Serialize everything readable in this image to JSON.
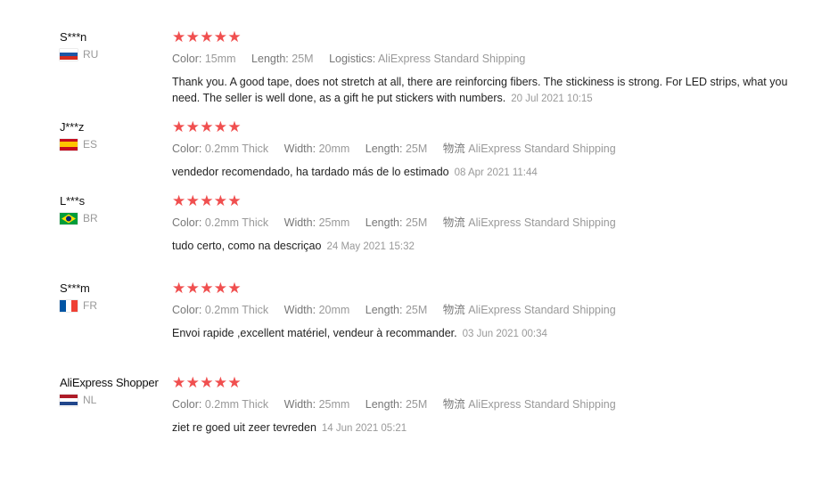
{
  "reviews": [
    {
      "user": "S***n",
      "country": "RU",
      "stars": "★★★★★",
      "attrs": [
        {
          "key": "Color:",
          "value": "15mm"
        },
        {
          "key": "Length:",
          "value": "25M"
        },
        {
          "key": "Logistics:",
          "value": "AliExpress Standard Shipping"
        }
      ],
      "text": "Thank you. A good tape, does not stretch at all, there are reinforcing fibers. The stickiness is strong. For LED strips, what you need. The seller is well done, as a gift he put stickers with numbers.",
      "date": "20 Jul 2021 10:15"
    },
    {
      "user": "J***z",
      "country": "ES",
      "stars": "★★★★★",
      "attrs": [
        {
          "key": "Color:",
          "value": "0.2mm Thick"
        },
        {
          "key": "Width:",
          "value": "20mm"
        },
        {
          "key": "Length:",
          "value": "25M"
        },
        {
          "key": "物流",
          "value": "AliExpress Standard Shipping"
        }
      ],
      "text": "vendedor recomendado, ha tardado más de lo estimado",
      "date": "08 Apr 2021 11:44"
    },
    {
      "user": "L***s",
      "country": "BR",
      "stars": "★★★★★",
      "attrs": [
        {
          "key": "Color:",
          "value": "0.2mm Thick"
        },
        {
          "key": "Width:",
          "value": "25mm"
        },
        {
          "key": "Length:",
          "value": "25M"
        },
        {
          "key": "物流",
          "value": "AliExpress Standard Shipping"
        }
      ],
      "text": "tudo certo, como na descriçao",
      "date": "24 May 2021 15:32"
    },
    {
      "user": "S***m",
      "country": "FR",
      "stars": "★★★★★",
      "attrs": [
        {
          "key": "Color:",
          "value": "0.2mm Thick"
        },
        {
          "key": "Width:",
          "value": "20mm"
        },
        {
          "key": "Length:",
          "value": "25M"
        },
        {
          "key": "物流",
          "value": "AliExpress Standard Shipping"
        }
      ],
      "text": "Envoi rapide ,excellent matériel, vendeur à recommander.",
      "date": "03 Jun 2021 00:34"
    },
    {
      "user": "AliExpress Shopper",
      "country": "NL",
      "stars": "★★★★★",
      "attrs": [
        {
          "key": "Color:",
          "value": "0.2mm Thick"
        },
        {
          "key": "Width:",
          "value": "25mm"
        },
        {
          "key": "Length:",
          "value": "25M"
        },
        {
          "key": "物流",
          "value": "AliExpress Standard Shipping"
        }
      ],
      "text": "ziet re goed uit zeer tevreden",
      "date": "14 Jun 2021 05:21"
    }
  ],
  "colors": {
    "star": "#f04f4f",
    "muted": "#999999",
    "text": "#222222"
  },
  "flags": {
    "RU": [
      "#ffffff",
      "#1c57a7",
      "#d52b1e"
    ],
    "ES": [
      "#c60b1e",
      "#ffc400",
      "#c60b1e"
    ],
    "FR": [
      "#0055a4",
      "#ffffff",
      "#ef4135"
    ],
    "NL": [
      "#ae1c28",
      "#ffffff",
      "#21468b"
    ],
    "BR": [
      "#009c3b",
      "#ffdf00",
      "#002776"
    ]
  }
}
